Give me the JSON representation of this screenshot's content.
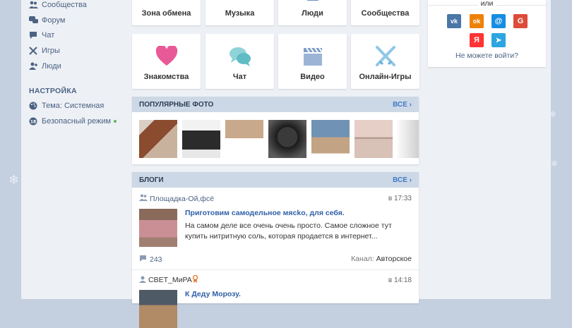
{
  "sidebar": {
    "items_top": [
      {
        "label": "Сообщества",
        "icon": "community-icon"
      },
      {
        "label": "Форум",
        "icon": "forum-icon"
      },
      {
        "label": "Чат",
        "icon": "chat-icon"
      },
      {
        "label": "Игры",
        "icon": "games-icon"
      },
      {
        "label": "Люди",
        "icon": "people-icon"
      }
    ],
    "settings_heading": "НАСТРОЙКА",
    "settings_items": [
      {
        "label": "Тема: Системная",
        "icon": "palette-icon"
      },
      {
        "label": "Безопасный режим",
        "icon": "safe-mode-icon"
      }
    ]
  },
  "tiles_row1": [
    "Зона обмена",
    "Музыка",
    "Люди",
    "Сообщества"
  ],
  "tiles_row2": [
    "Знакомства",
    "Чат",
    "Видео",
    "Онлайн-Игры"
  ],
  "popular_photos": {
    "title": "ПОПУЛЯРНЫЕ ФОТО",
    "all_label": "ВСЕ"
  },
  "blogs": {
    "title": "БЛОГИ",
    "all_label": "ВСЕ",
    "posts": [
      {
        "author": "Площадка-Ой,фсё",
        "time": "в 17:33",
        "title": "Приготовим самодельное мясko, для себя.",
        "text": "На самом деле все очень очень просто. Самое сложное тут купить нитритную соль, которая продается в интернет...",
        "comments": "243",
        "channel_label": "Канал:",
        "channel_value": "Авторское"
      },
      {
        "author": "СВЕТ_МиРА",
        "time": "в 14:18",
        "title": "К Деду Морозу."
      }
    ]
  },
  "login": {
    "or_label": "или",
    "cant_login": "Не можете войти?",
    "socials": [
      {
        "name": "vk",
        "glyph": "vk",
        "color": "#4a76a8"
      },
      {
        "name": "ok",
        "glyph": "ok",
        "color": "#ee8208"
      },
      {
        "name": "mail",
        "glyph": "@",
        "color": "#168de2"
      },
      {
        "name": "google",
        "glyph": "G",
        "color": "#dd4b39"
      },
      {
        "name": "yandex",
        "glyph": "Я",
        "color": "#f33"
      },
      {
        "name": "telegram",
        "glyph": "➤",
        "color": "#2ca5e0"
      }
    ]
  },
  "colors": {
    "accent": "#3f78c9",
    "sidebar_text": "#4b6283",
    "panel_head": "#cdd8e6"
  }
}
